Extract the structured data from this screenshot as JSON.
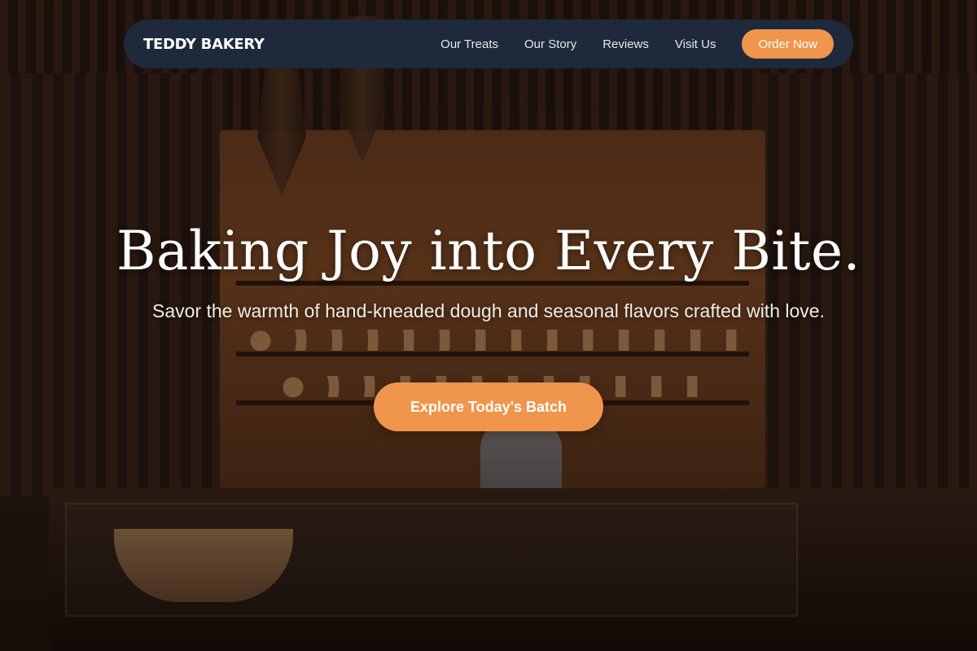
{
  "header": {
    "brand": "TEDDY BAKERY",
    "nav": [
      {
        "label": "Our Treats"
      },
      {
        "label": "Our Story"
      },
      {
        "label": "Reviews"
      },
      {
        "label": "Visit Us"
      }
    ],
    "cta_label": "Order Now"
  },
  "hero": {
    "title": "Baking Joy into Every Bite.",
    "subtitle": "Savor the warmth of hand-kneaded dough and seasonal flavors crafted with love.",
    "button_label": "Explore Today's Batch",
    "background_image": "bakery-interior-photo"
  },
  "colors": {
    "accent": "#f0954c",
    "nav_background": "#1e2a3b",
    "text_light": "#ffffff"
  }
}
